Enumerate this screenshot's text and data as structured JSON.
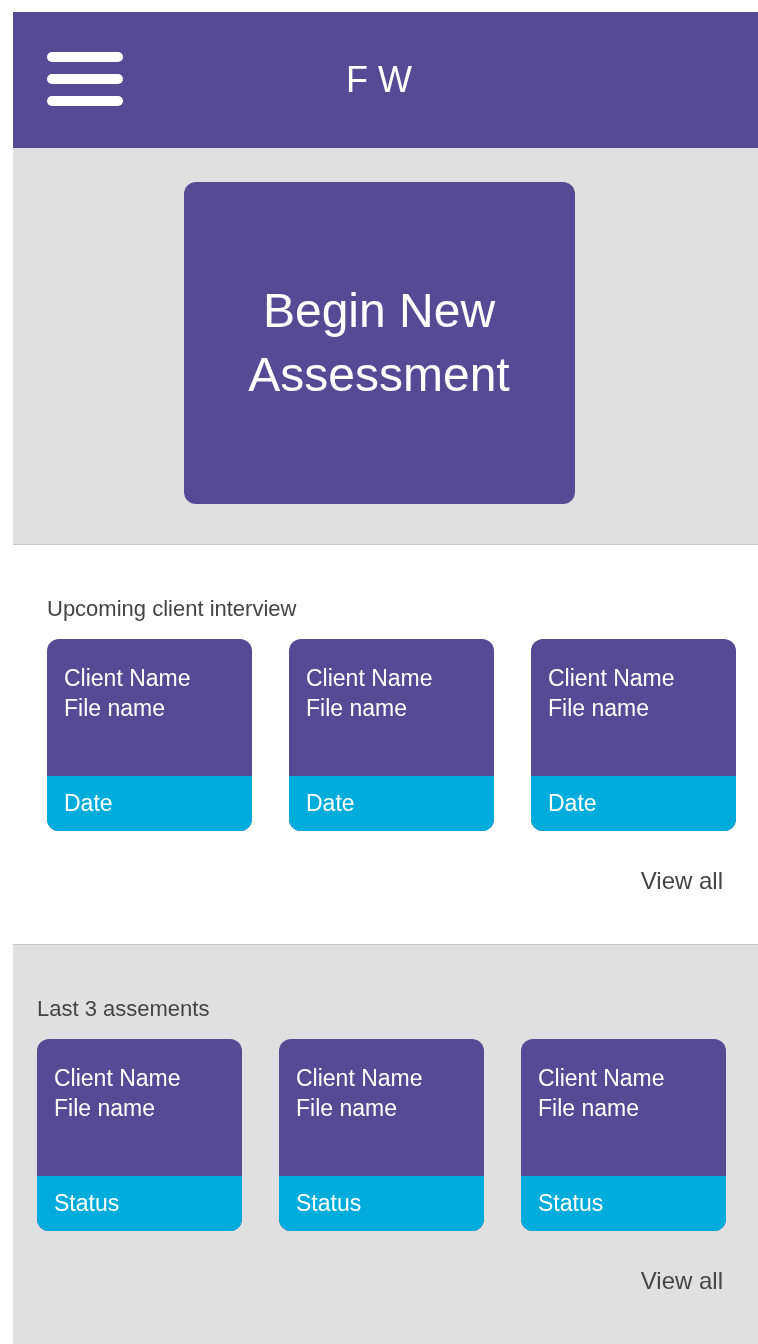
{
  "header": {
    "title": "F W"
  },
  "primary_action": {
    "label": "Begin New Assessment"
  },
  "sections": [
    {
      "title": "Upcoming client interview",
      "shaded": false,
      "cards": [
        {
          "lines": [
            "Client Name",
            "File name"
          ],
          "footer": "Date"
        },
        {
          "lines": [
            "Client Name",
            "File name"
          ],
          "footer": "Date"
        },
        {
          "lines": [
            "Client Name",
            "File name"
          ],
          "footer": "Date"
        }
      ],
      "link": "View all"
    },
    {
      "title": "Last 3 assements",
      "shaded": true,
      "cards": [
        {
          "lines": [
            "Client Name",
            "File name"
          ],
          "footer": "Status"
        },
        {
          "lines": [
            "Client Name",
            "File name"
          ],
          "footer": "Status"
        },
        {
          "lines": [
            "Client Name",
            "File name"
          ],
          "footer": "Status"
        }
      ],
      "link": "View all"
    }
  ]
}
